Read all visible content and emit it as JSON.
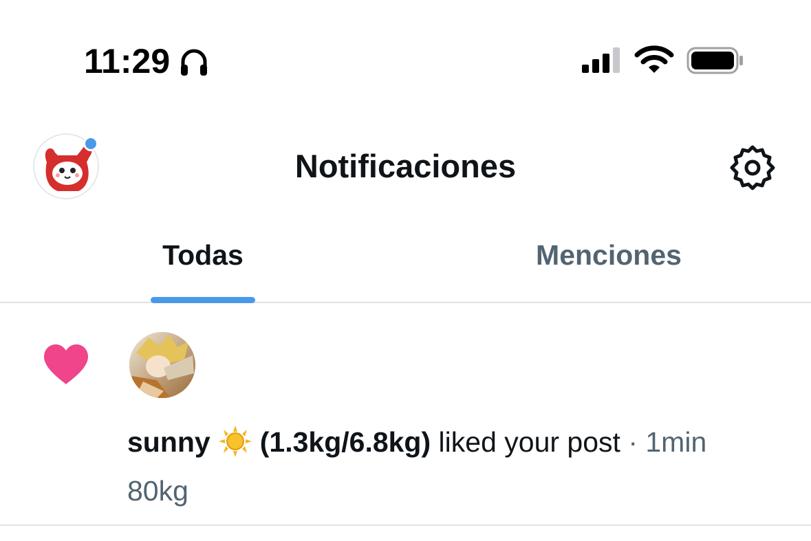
{
  "status_bar": {
    "time": "11:29"
  },
  "header": {
    "title": "Notificaciones",
    "unread_dot_color": "#4a99e9"
  },
  "tabs": [
    {
      "label": "Todas",
      "active": true
    },
    {
      "label": "Menciones",
      "active": false
    }
  ],
  "notifications": [
    {
      "type": "like",
      "icon": "heart-icon",
      "icon_color": "#f0448b",
      "user_name_prefix": "sunny",
      "user_name_emoji": "sun-icon",
      "user_name_suffix": "(1.3kg/6.8kg)",
      "action": "liked your post",
      "separator": "·",
      "time": "1min",
      "post_preview": "80kg"
    }
  ],
  "colors": {
    "accent": "#4a99e9",
    "text_primary": "#0f1419",
    "text_secondary": "#536471",
    "divider": "#dfe3e7",
    "like": "#f0448b"
  }
}
